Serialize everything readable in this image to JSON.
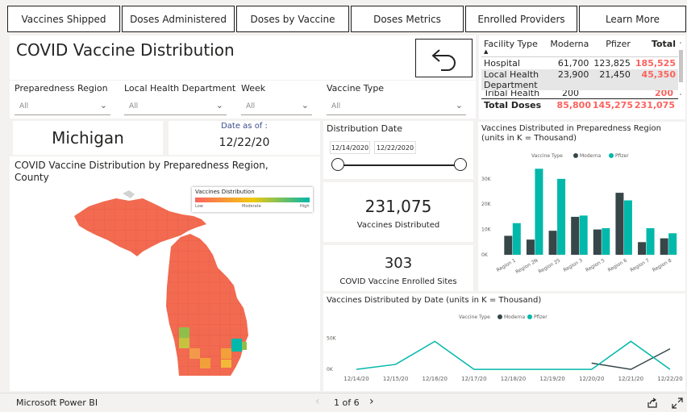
{
  "nav": [
    "Vaccines Shipped",
    "Doses Administered",
    "Doses by Vaccine",
    "Doses Metrics",
    "Enrolled Providers",
    "Learn More"
  ],
  "title": "COVID Vaccine Distribution",
  "filters": {
    "preparedness_region": {
      "label": "Preparedness Region",
      "value": "All"
    },
    "local_health_department": {
      "label": "Local Health Department",
      "value": "All"
    },
    "week": {
      "label": "Week",
      "value": "All"
    },
    "vaccine_type": {
      "label": "Vaccine Type",
      "value": "All"
    }
  },
  "state": "Michigan",
  "date_as_of": {
    "label": "Date as of :",
    "value": "12/22/20"
  },
  "distribution_date": {
    "label": "Distribution Date",
    "start": "12/14/2020",
    "end": "12/22/2020"
  },
  "map": {
    "title": "COVID Vaccine Distribution by Preparedness Region, County",
    "legend_title": "Vaccines Distribution",
    "legend_low": "Low",
    "legend_mid": "Moderate",
    "legend_high": "High"
  },
  "kpi_vaccines": {
    "value": "231,075",
    "label": "Vaccines Distributed"
  },
  "kpi_sites": {
    "value": "303",
    "label": "COVID Vaccine Enrolled Sites"
  },
  "facility_table": {
    "headers": [
      "Facility Type",
      "Moderna",
      "Pfizer",
      "Total"
    ],
    "rows": [
      [
        "Hospital",
        "61,700",
        "123,825",
        "185,525"
      ],
      [
        "Local Health Department",
        "23,900",
        "21,450",
        "45,350"
      ],
      [
        "Tribal Health",
        "200",
        "",
        "200"
      ]
    ],
    "totals": [
      "Total Doses",
      "85,800",
      "145,275",
      "231,075"
    ]
  },
  "colors": {
    "moderna": "#374649",
    "pfizer": "#01b8aa",
    "total_red": "#fd625e"
  },
  "chart_data": [
    {
      "type": "bar",
      "title": "Vaccines Distributed in Preparedness Region (units in K = Thousand)",
      "legend_title": "Vaccine Type",
      "categories": [
        "Region 1",
        "Region 2N",
        "Region 2S",
        "Region 3",
        "Region 5",
        "Region 6",
        "Region 7",
        "Region 8"
      ],
      "series": [
        {
          "name": "Moderna",
          "values": [
            7.5,
            6,
            9.5,
            15,
            10,
            24.5,
            5,
            6.5
          ]
        },
        {
          "name": "Pfizer",
          "values": [
            12.5,
            34,
            30,
            15.5,
            10.5,
            21.5,
            10.5,
            8.5
          ]
        }
      ],
      "yticks": [
        "0K",
        "10K",
        "20K",
        "30K"
      ],
      "ylim": [
        0,
        36
      ]
    },
    {
      "type": "line",
      "title": "Vaccines Distributed by Date (units in K = Thousand)",
      "legend_title": "Vaccine Type",
      "x": [
        "12/14/20",
        "12/15/20",
        "12/16/20",
        "12/17/20",
        "12/18/20",
        "12/19/20",
        "12/20/20",
        "12/21/20",
        "12/22/20"
      ],
      "series": [
        {
          "name": "Moderna",
          "values": [
            null,
            null,
            null,
            null,
            null,
            null,
            10,
            0,
            33
          ]
        },
        {
          "name": "Pfizer",
          "values": [
            0,
            8,
            45,
            0,
            0,
            0,
            0,
            45,
            0
          ]
        }
      ],
      "yticks": [
        "0K",
        "50K"
      ],
      "ylim": [
        -5,
        70
      ]
    }
  ],
  "footer": {
    "brand": "Microsoft Power BI",
    "page": "1 of 6"
  }
}
